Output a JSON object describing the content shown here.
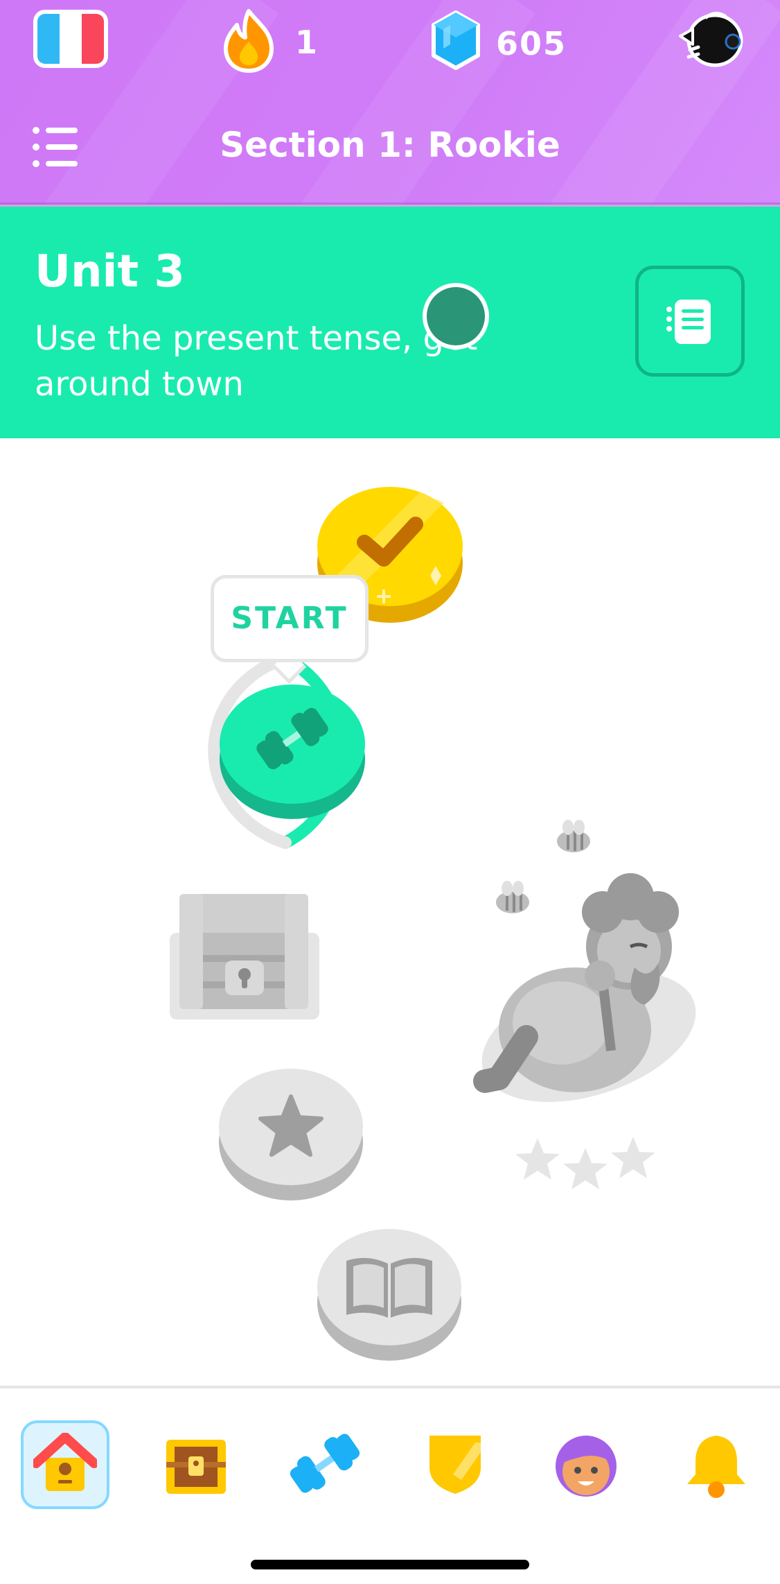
{
  "header": {
    "language": "French",
    "streak_count": "1",
    "gems_count": "605",
    "section_title": "Section 1: Rookie"
  },
  "unit": {
    "title": "Unit 3",
    "subtitle": "Use the present tense, get around town"
  },
  "path": {
    "start_label": "START"
  },
  "icons": {
    "flag": "france-flag-icon",
    "streak": "flame-icon",
    "gems": "gem-icon",
    "profile": "bird-mascot-icon",
    "menu": "list-menu-icon",
    "guidebook": "guidebook-icon",
    "completed": "checkmark-coin-icon",
    "practice": "dumbbell-icon",
    "chest": "treasure-chest-icon",
    "star": "star-icon",
    "story": "book-icon",
    "character": "sleeping-character-icon"
  },
  "nav": {
    "items": [
      "learn",
      "chest",
      "practice",
      "leagues",
      "profile",
      "notifications"
    ]
  },
  "colors": {
    "header_purple": "#ce82ff",
    "banner_green": "#1cebaf",
    "start_text": "#1fd3a0",
    "locked_gray": "#e5e5e5"
  }
}
